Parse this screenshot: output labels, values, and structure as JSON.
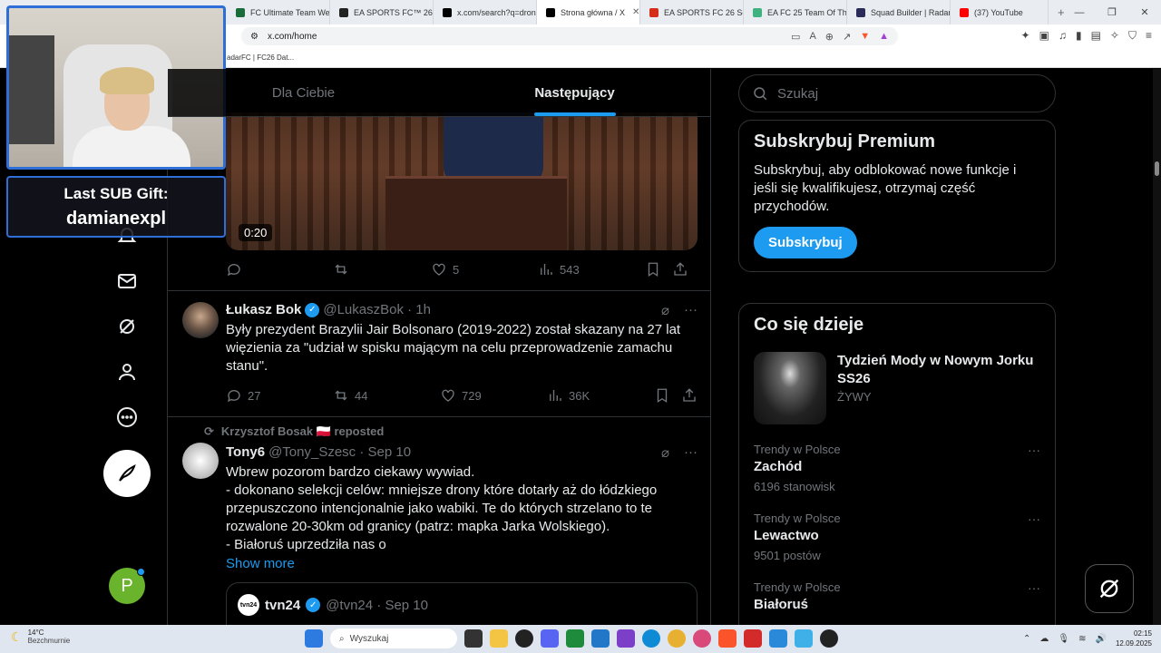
{
  "browser": {
    "tabs": [
      {
        "label": "FC Ultimate Team Web...",
        "color": "#1a6d3a",
        "active": false
      },
      {
        "label": "EA SPORTS FC™ 26 | S...",
        "color": "#222222",
        "active": false
      },
      {
        "label": "x.com/search?q=dron...",
        "color": "#000000",
        "active": false
      },
      {
        "label": "Strona główna / X",
        "color": "#000000",
        "active": true
      },
      {
        "label": "EA SPORTS FC 26 Squ...",
        "color": "#d62c1a",
        "active": false
      },
      {
        "label": "EA FC 25 Team Of The...",
        "color": "#3fb27f",
        "active": false
      },
      {
        "label": "Squad Builder | Radar...",
        "color": "#2b2b5a",
        "active": false
      },
      {
        "label": "(37) YouTube",
        "color": "#ff0000",
        "active": false
      }
    ],
    "url": "x.com/home",
    "bookmark": "adarFC | FC26 Dat..."
  },
  "overlay": {
    "sub_label": "Last SUB Gift:",
    "sub_name": "damianexpl"
  },
  "feed": {
    "tabs": [
      "Dla Ciebie",
      "Następujący"
    ],
    "video_time": "0:20",
    "post0_actions": {
      "replies": "",
      "reposts": "",
      "likes": "5",
      "views": "543"
    },
    "post1": {
      "name": "Łukasz Bok",
      "handle": "@LukaszBok · 1h",
      "text": "Były prezydent Brazylii Jair Bolsonaro (2019-2022) został skazany na 27 lat więzienia za \"udział w spisku mającym na celu przeprowadzenie zamachu stanu\".",
      "replies": "27",
      "reposts": "44",
      "likes": "729",
      "views": "36K"
    },
    "post2": {
      "repost_by": "Krzysztof Bosak 🇵🇱 reposted",
      "name": "Tony6",
      "handle": "@Tony_Szesc · Sep 10",
      "text": "Wbrew pozorom bardzo ciekawy wywiad.\n- dokonano selekcji celów: mniejsze drony które dotarły aż do łódzkiego przepuszczono intencjonalnie jako wabiki. Te do których strzelano to te rozwalone 20-30km od granicy (patrz: mapka Jarka Wolskiego).\n- Białoruś uprzedziła nas o",
      "show_more": "Show more",
      "quote_logo": "tvn24",
      "quote_name": "tvn24",
      "quote_handle": "@tvn24 · Sep 10"
    }
  },
  "sidebar": {
    "search_placeholder": "Szukaj",
    "premium": {
      "title": "Subskrybuj Premium",
      "text": "Subskrybuj, aby odblokować nowe funkcje i jeśli się kwalifikujesz, otrzymaj część przychodów.",
      "button": "Subskrybuj"
    },
    "trends_title": "Co się dzieje",
    "event": {
      "title": "Tydzień Mody w Nowym Jorku SS26",
      "status": "ŻYWY"
    },
    "trends": [
      {
        "context": "Trendy w Polsce",
        "name": "Zachód",
        "posts": "6196 stanowisk"
      },
      {
        "context": "Trendy w Polsce",
        "name": "Lewactwo",
        "posts": "9501 postów"
      },
      {
        "context": "Trendy w Polsce",
        "name": "Białoruś",
        "posts": ""
      }
    ]
  },
  "profile_initial": "P",
  "taskbar": {
    "temp": "14°C",
    "weather": "Bezchmurnie",
    "search": "Wyszukaj",
    "time": "02:15",
    "date": "12.09.2025"
  }
}
